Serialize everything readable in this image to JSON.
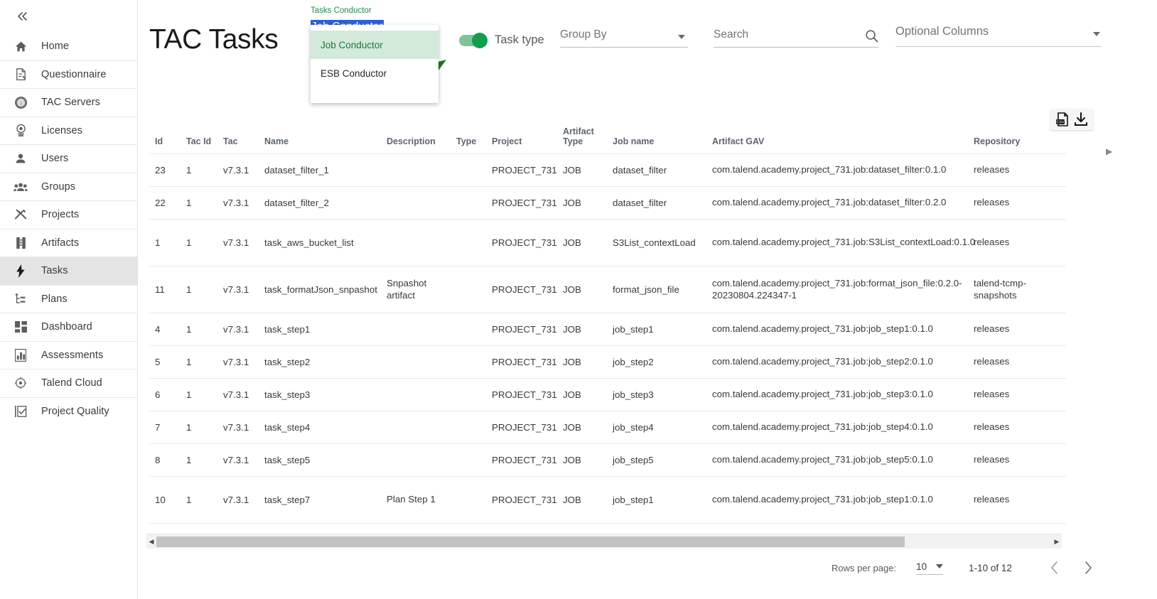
{
  "sidebar": {
    "collapse_icon": "chevron-double-left-icon",
    "items": [
      {
        "label": "Home",
        "icon": "home-icon",
        "selected": false
      },
      {
        "label": "Questionnaire",
        "icon": "questionnaire-icon",
        "selected": false
      },
      {
        "label": "TAC Servers",
        "icon": "tac-servers-icon",
        "selected": false
      },
      {
        "label": "Licenses",
        "icon": "license-badge-icon",
        "selected": false
      },
      {
        "label": "Users",
        "icon": "user-icon",
        "selected": false
      },
      {
        "label": "Groups",
        "icon": "groups-icon",
        "selected": false
      },
      {
        "label": "Projects",
        "icon": "tools-icon",
        "selected": false
      },
      {
        "label": "Artifacts",
        "icon": "artifact-icon",
        "selected": false
      },
      {
        "label": "Tasks",
        "icon": "lightning-bolt-icon",
        "selected": true
      },
      {
        "label": "Plans",
        "icon": "plan-tree-icon",
        "selected": false
      },
      {
        "label": "Dashboard",
        "icon": "dashboard-grid-icon",
        "selected": false
      },
      {
        "label": "Assessments",
        "icon": "bar-chart-icon",
        "selected": false
      },
      {
        "label": "Talend Cloud",
        "icon": "talend-cloud-icon",
        "selected": false
      },
      {
        "label": "Project Quality",
        "icon": "project-quality-icon",
        "selected": false
      }
    ]
  },
  "toolbar": {
    "page_title": "TAC Tasks",
    "conductor_select": {
      "label": "Tasks Conductor",
      "value": "Job Conductor",
      "expanded": true,
      "options": [
        {
          "label": "Job Conductor",
          "active": true
        },
        {
          "label": "ESB Conductor",
          "active": false
        }
      ]
    },
    "task_type": {
      "label": "Task type",
      "enabled": true
    },
    "group_by": {
      "label": "Group By",
      "value": ""
    },
    "search": {
      "placeholder": "Search",
      "value": "",
      "icon": "search-icon"
    },
    "optional_columns": {
      "label": "Optional Columns",
      "value": ""
    },
    "export": {
      "csv_icon": "csv-file-icon",
      "download_icon": "download-icon"
    },
    "annotation": {
      "type": "arrow",
      "color": "#1d7a16"
    }
  },
  "table": {
    "columns": [
      "Id",
      "Tac Id",
      "Tac",
      "Name",
      "Description",
      "Type",
      "Project",
      "Artifact Type",
      "Job name",
      "Artifact GAV",
      "Repository"
    ],
    "rows": [
      {
        "id": "23",
        "tac_id": "1",
        "tac": "v7.3.1",
        "name": "dataset_filter_1",
        "description": "",
        "type": "",
        "project": "PROJECT_731",
        "artifact_type": "JOB",
        "job_name": "dataset_filter",
        "artifact_gav": "com.talend.academy.project_731.job:dataset_filter:0.1.0",
        "repository": "releases",
        "tall": false
      },
      {
        "id": "22",
        "tac_id": "1",
        "tac": "v7.3.1",
        "name": "dataset_filter_2",
        "description": "",
        "type": "",
        "project": "PROJECT_731",
        "artifact_type": "JOB",
        "job_name": "dataset_filter",
        "artifact_gav": "com.talend.academy.project_731.job:dataset_filter:0.2.0",
        "repository": "releases",
        "tall": false
      },
      {
        "id": "1",
        "tac_id": "1",
        "tac": "v7.3.1",
        "name": "task_aws_bucket_list",
        "description": "",
        "type": "",
        "project": "PROJECT_731",
        "artifact_type": "JOB",
        "job_name": "S3List_contextLoad",
        "artifact_gav": "com.talend.academy.project_731.job:S3List_contextLoad:0.1.0",
        "repository": "releases",
        "tall": true
      },
      {
        "id": "11",
        "tac_id": "1",
        "tac": "v7.3.1",
        "name": "task_formatJson_snpashot",
        "description": "Snpashot artifact",
        "type": "",
        "project": "PROJECT_731",
        "artifact_type": "JOB",
        "job_name": "format_json_file",
        "artifact_gav": "com.talend.academy.project_731.job:format_json_file:0.2.0-20230804.224347-1",
        "repository": "talend-tcmp-snapshots",
        "tall": true
      },
      {
        "id": "4",
        "tac_id": "1",
        "tac": "v7.3.1",
        "name": "task_step1",
        "description": "",
        "type": "",
        "project": "PROJECT_731",
        "artifact_type": "JOB",
        "job_name": "job_step1",
        "artifact_gav": "com.talend.academy.project_731.job:job_step1:0.1.0",
        "repository": "releases",
        "tall": false
      },
      {
        "id": "5",
        "tac_id": "1",
        "tac": "v7.3.1",
        "name": "task_step2",
        "description": "",
        "type": "",
        "project": "PROJECT_731",
        "artifact_type": "JOB",
        "job_name": "job_step2",
        "artifact_gav": "com.talend.academy.project_731.job:job_step2:0.1.0",
        "repository": "releases",
        "tall": false
      },
      {
        "id": "6",
        "tac_id": "1",
        "tac": "v7.3.1",
        "name": "task_step3",
        "description": "",
        "type": "",
        "project": "PROJECT_731",
        "artifact_type": "JOB",
        "job_name": "job_step3",
        "artifact_gav": "com.talend.academy.project_731.job:job_step3:0.1.0",
        "repository": "releases",
        "tall": false
      },
      {
        "id": "7",
        "tac_id": "1",
        "tac": "v7.3.1",
        "name": "task_step4",
        "description": "",
        "type": "",
        "project": "PROJECT_731",
        "artifact_type": "JOB",
        "job_name": "job_step4",
        "artifact_gav": "com.talend.academy.project_731.job:job_step4:0.1.0",
        "repository": "releases",
        "tall": false
      },
      {
        "id": "8",
        "tac_id": "1",
        "tac": "v7.3.1",
        "name": "task_step5",
        "description": "",
        "type": "",
        "project": "PROJECT_731",
        "artifact_type": "JOB",
        "job_name": "job_step5",
        "artifact_gav": "com.talend.academy.project_731.job:job_step5:0.1.0",
        "repository": "releases",
        "tall": false
      },
      {
        "id": "10",
        "tac_id": "1",
        "tac": "v7.3.1",
        "name": "task_step7",
        "description": "Plan Step 1",
        "type": "",
        "project": "PROJECT_731",
        "artifact_type": "JOB",
        "job_name": "job_step1",
        "artifact_gav": "com.talend.academy.project_731.job:job_step1:0.1.0",
        "repository": "releases",
        "tall": true
      }
    ]
  },
  "pagination": {
    "rows_per_page_label": "Rows per page:",
    "rows_per_page_value": "10",
    "range": "1-10 of 12",
    "prev_icon": "chevron-left-icon",
    "next_icon": "chevron-right-icon"
  },
  "scrollbar": {
    "left_arrow": "triangle-left-icon",
    "right_arrow": "triangle-right-icon"
  },
  "colors": {
    "accent_green": "#1a7a3e",
    "toggle_green": "#0e9f4f",
    "selection_blue": "#2f5fd0",
    "menu_highlight": "#d3eadb",
    "annotation_green": "#1d7a16"
  }
}
